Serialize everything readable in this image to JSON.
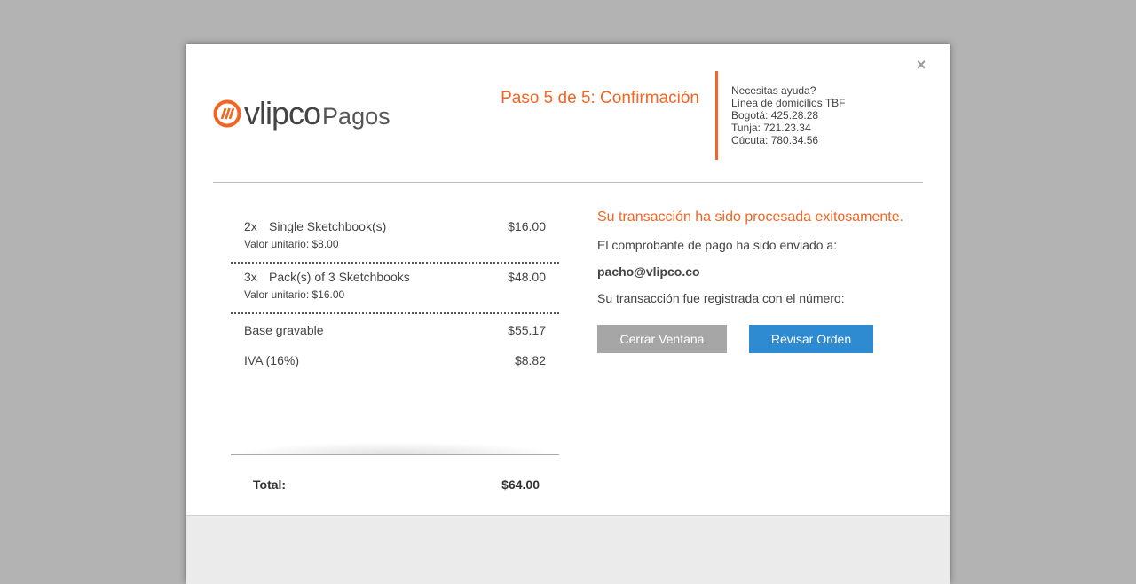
{
  "close_symbol": "×",
  "brand": {
    "word": "vlipco",
    "sub": "Pagos",
    "accent": "#f26522"
  },
  "step_title": "Paso 5 de 5: Confirmación",
  "help": {
    "lines": [
      "Necesitas ayuda?",
      "Línea de domicilios TBF",
      "Bogotá: 425.28.28",
      "Tunja: 721.23.34",
      "Cúcuta: 780.34.56"
    ]
  },
  "order": {
    "items": [
      {
        "qty": "2x",
        "name": "Single Sketchbook(s)",
        "price": "$16.00",
        "unit": "Valor unitario: $8.00"
      },
      {
        "qty": "3x",
        "name": "Pack(s) of 3 Sketchbooks",
        "price": "$48.00",
        "unit": "Valor unitario: $16.00"
      }
    ],
    "base_label": "Base gravable",
    "base_value": "$55.17",
    "iva_label": "IVA (16%)",
    "iva_value": "$8.82",
    "total_label": "Total:",
    "total_value": "$64.00"
  },
  "confirmation": {
    "headline": "Su transacción ha sido procesada exitosamente.",
    "sent_to": "El comprobante de pago ha sido enviado a:",
    "email": "pacho@vlipco.co",
    "registered": "Su transacción fue registrada con el número:"
  },
  "buttons": {
    "close_window": "Cerrar Ventana",
    "review_order": "Revisar Orden"
  },
  "colors": {
    "primary_button": "#2e8bd1",
    "secondary_button": "#a6a6a6",
    "backdrop": "#b3b3b3"
  }
}
